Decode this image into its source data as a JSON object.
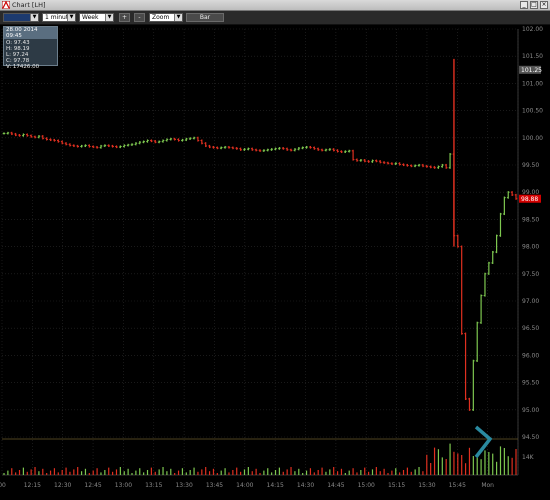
{
  "window": {
    "title": "Chart [LH]",
    "app_icon": "chart-app-icon",
    "controls": [
      "minimize",
      "maximize",
      "close"
    ]
  },
  "toolbar": {
    "symbol_value": "",
    "interval_value": "1 minute",
    "range_value": "Week",
    "zoom_in_label": "+",
    "zoom_out_label": "-",
    "zoom_value": "Zoom",
    "chart_type_label": "Bar"
  },
  "infobox": {
    "header": "28.00 2014 09:45",
    "open": "O: 97.43",
    "high": "H: 98.19",
    "low": "L: 97.24",
    "close": "C: 97.78",
    "volume": "V: 17426.00"
  },
  "chart_data": {
    "type": "bar",
    "price_axis_ticks": [
      "102.00",
      "101.50",
      "101.00",
      "100.50",
      "100.00",
      "99.50",
      "99.00",
      "98.50",
      "98.00",
      "97.50",
      "97.00",
      "96.50",
      "96.00",
      "95.50",
      "95.00",
      "94.50"
    ],
    "ylim": [
      94.5,
      102.0
    ],
    "price_markers": [
      {
        "value": 101.25,
        "label": "101.25",
        "color": "#555555"
      },
      {
        "value": 98.88,
        "label": "98.88",
        "color": "#d40000"
      }
    ],
    "time_axis_ticks": [
      "00",
      "12:15",
      "12:30",
      "12:45",
      "13:00",
      "13:15",
      "13:30",
      "13:45",
      "14:00",
      "14:15",
      "14:30",
      "14:45",
      "15:00",
      "15:15",
      "15:30",
      "15:45",
      "Mon",
      ""
    ],
    "volume_axis_label": "14K",
    "colors": {
      "up": "#7ec850",
      "down": "#e03020",
      "grid": "#2a2a2a",
      "axis": "#8a8a8a",
      "pointer": "#2a8aa0"
    },
    "close_series": [
      100.08,
      100.09,
      100.07,
      100.05,
      100.04,
      100.06,
      100.04,
      100.02,
      100.01,
      100.03,
      99.99,
      99.97,
      99.96,
      99.95,
      99.93,
      99.9,
      99.88,
      99.86,
      99.85,
      99.84,
      99.85,
      99.86,
      99.84,
      99.83,
      99.82,
      99.85,
      99.86,
      99.85,
      99.84,
      99.83,
      99.84,
      99.86,
      99.87,
      99.88,
      99.9,
      99.92,
      99.93,
      99.95,
      99.94,
      99.92,
      99.93,
      99.95,
      99.97,
      99.98,
      99.97,
      99.95,
      99.96,
      99.98,
      99.99,
      100.0,
      99.95,
      99.9,
      99.85,
      99.83,
      99.82,
      99.81,
      99.82,
      99.83,
      99.82,
      99.81,
      99.8,
      99.78,
      99.79,
      99.8,
      99.78,
      99.77,
      99.76,
      99.77,
      99.78,
      99.79,
      99.8,
      99.81,
      99.8,
      99.78,
      99.77,
      99.79,
      99.81,
      99.82,
      99.83,
      99.82,
      99.8,
      99.78,
      99.77,
      99.78,
      99.79,
      99.77,
      99.75,
      99.74,
      99.75,
      99.76,
      99.6,
      99.58,
      99.59,
      99.57,
      99.56,
      99.58,
      99.57,
      99.55,
      99.54,
      99.53,
      99.52,
      99.53,
      99.51,
      99.5,
      99.49,
      99.48,
      99.49,
      99.5,
      99.48,
      99.47,
      99.46,
      99.45,
      99.47,
      99.5,
      99.45,
      99.7,
      98.2,
      98.0,
      96.4,
      95.2,
      95.0,
      95.9,
      96.6,
      97.1,
      97.5,
      97.7,
      97.9,
      98.2,
      98.6,
      98.9,
      99.0,
      98.95,
      98.88
    ]
  }
}
